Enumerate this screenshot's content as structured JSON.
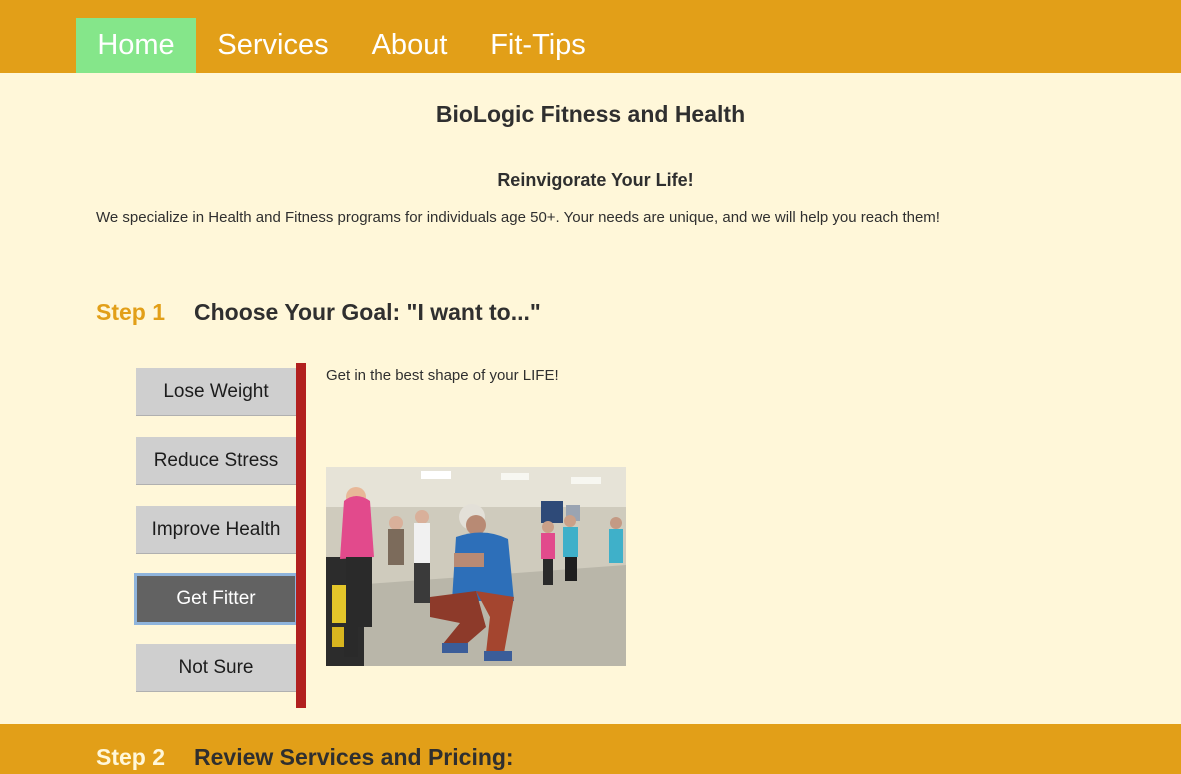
{
  "nav": {
    "items": [
      {
        "label": "Home",
        "active": true
      },
      {
        "label": "Services",
        "active": false
      },
      {
        "label": "About",
        "active": false
      },
      {
        "label": "Fit-Tips",
        "active": false
      }
    ]
  },
  "header": {
    "title": "BioLogic Fitness and Health",
    "tagline": "Reinvigorate Your Life!",
    "intro": "We specialize in Health and Fitness programs for individuals age 50+. Your needs are unique, and we will help you reach them!"
  },
  "step1": {
    "label": "Step 1",
    "heading": "Choose Your Goal: \"I want to...\"",
    "goals": [
      {
        "label": "Lose Weight",
        "selected": false
      },
      {
        "label": "Reduce Stress",
        "selected": false
      },
      {
        "label": "Improve Health",
        "selected": false
      },
      {
        "label": "Get Fitter",
        "selected": true
      },
      {
        "label": "Not Sure",
        "selected": false
      }
    ],
    "description": "Get in the best shape of your LIFE!",
    "photo_icon": "fitness-class-photo"
  },
  "step2": {
    "label": "Step 2",
    "heading": "Review Services and Pricing:"
  },
  "colors": {
    "nav_bg": "#e29f18",
    "nav_active": "#85e68a",
    "page_bg": "#fff7d9",
    "accent_red": "#b2201f",
    "button_bg": "#cfcfcf",
    "button_selected": "#626262"
  }
}
